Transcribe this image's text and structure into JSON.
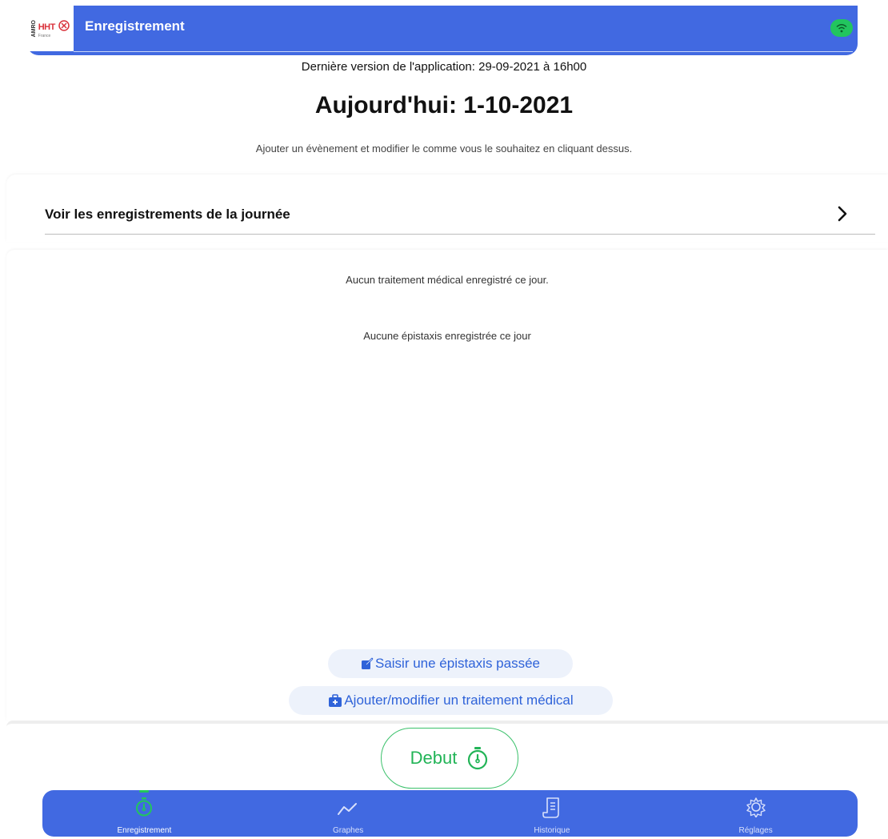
{
  "header": {
    "title": "Enregistrement",
    "logo_text": "HHT",
    "logo_side": "AMRO",
    "logo_sub": "France",
    "accent_color": "#4169e1",
    "status_icon": "wifi-icon"
  },
  "info": {
    "version": "Dernière version de l'application: 29-09-2021 à 16h00",
    "today": "Aujourd'hui: 1-10-2021",
    "hint": "Ajouter un évènement et modifier le comme vous le souhaitez en cliquant dessus."
  },
  "records_link": {
    "label": "Voir les enregistrements de la journée",
    "icon": "chevron-right-icon"
  },
  "day_summary": {
    "treatment_empty": "Aucun traitement médical enregistré ce jour.",
    "epistaxis_empty": "Aucune épistaxis enregistrée ce jour"
  },
  "actions": {
    "past_epistaxis": "Saisir une épistaxis passée",
    "past_epistaxis_icon": "edit-icon",
    "treatment": "Ajouter/modifier un traitement médical",
    "treatment_icon": "medical-kit-icon"
  },
  "start_button": {
    "label": "Debut",
    "icon": "stopwatch-icon",
    "color": "#22b457"
  },
  "tabs": [
    {
      "label": "Enregistrement",
      "icon": "stopwatch-icon",
      "active": true
    },
    {
      "label": "Graphes",
      "icon": "chart-line-icon",
      "active": false
    },
    {
      "label": "Historique",
      "icon": "document-icon",
      "active": false
    },
    {
      "label": "Réglages",
      "icon": "gear-icon",
      "active": false
    }
  ]
}
